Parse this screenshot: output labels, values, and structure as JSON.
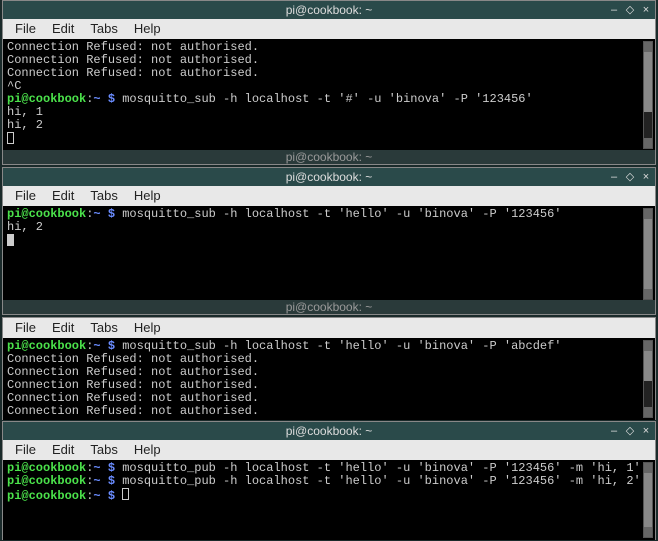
{
  "windows": [
    {
      "title": "pi@cookbook: ~",
      "menu": [
        "File",
        "Edit",
        "Tabs",
        "Help"
      ],
      "lines": [
        {
          "segs": [
            {
              "cls": "white",
              "t": "Connection Refused: not authorised."
            }
          ]
        },
        {
          "segs": [
            {
              "cls": "white",
              "t": "Connection Refused: not authorised."
            }
          ]
        },
        {
          "segs": [
            {
              "cls": "white",
              "t": "Connection Refused: not authorised."
            }
          ]
        },
        {
          "segs": [
            {
              "cls": "white",
              "t": "^C"
            }
          ]
        },
        {
          "segs": [
            {
              "cls": "green",
              "t": "pi@cookbook"
            },
            {
              "cls": "white",
              "t": ":"
            },
            {
              "cls": "blue",
              "t": "~ $ "
            },
            {
              "cls": "cmd",
              "t": "mosquitto_sub -h localhost -t '#' -u 'binova' -P '123456'"
            }
          ]
        },
        {
          "segs": [
            {
              "cls": "white",
              "t": "hi, 1"
            }
          ]
        },
        {
          "segs": [
            {
              "cls": "white",
              "t": "hi, 2"
            }
          ]
        }
      ],
      "cursor": "box",
      "partial_below": "pi@cookbook: ~"
    },
    {
      "title": "pi@cookbook: ~",
      "menu": [
        "File",
        "Edit",
        "Tabs",
        "Help"
      ],
      "lines": [
        {
          "segs": [
            {
              "cls": "green",
              "t": "pi@cookbook"
            },
            {
              "cls": "white",
              "t": ":"
            },
            {
              "cls": "blue",
              "t": "~ $ "
            },
            {
              "cls": "cmd",
              "t": "mosquitto_sub -h localhost -t 'hello' -u 'binova' -P '123456'"
            }
          ]
        },
        {
          "segs": [
            {
              "cls": "white",
              "t": "hi, 2"
            }
          ]
        }
      ],
      "cursor": "fill",
      "partial_below": "pi@cookbook: ~"
    },
    {
      "title": "",
      "menu": [
        "File",
        "Edit",
        "Tabs",
        "Help"
      ],
      "lines": [
        {
          "segs": [
            {
              "cls": "green",
              "t": "pi@cookbook"
            },
            {
              "cls": "white",
              "t": ":"
            },
            {
              "cls": "blue",
              "t": "~ $ "
            },
            {
              "cls": "cmd",
              "t": "mosquitto_sub -h localhost -t 'hello' -u 'binova' -P 'abcdef'"
            }
          ]
        },
        {
          "segs": [
            {
              "cls": "white",
              "t": "Connection Refused: not authorised."
            }
          ]
        },
        {
          "segs": [
            {
              "cls": "white",
              "t": "Connection Refused: not authorised."
            }
          ]
        },
        {
          "segs": [
            {
              "cls": "white",
              "t": "Connection Refused: not authorised."
            }
          ]
        },
        {
          "segs": [
            {
              "cls": "white",
              "t": "Connection Refused: not authorised."
            }
          ]
        },
        {
          "segs": [
            {
              "cls": "white",
              "t": "Connection Refused: not authorised."
            }
          ]
        }
      ],
      "cursor": "none"
    },
    {
      "title": "pi@cookbook: ~",
      "menu": [
        "File",
        "Edit",
        "Tabs",
        "Help"
      ],
      "lines": [
        {
          "segs": [
            {
              "cls": "green",
              "t": "pi@cookbook"
            },
            {
              "cls": "white",
              "t": ":"
            },
            {
              "cls": "blue",
              "t": "~ $ "
            },
            {
              "cls": "cmd",
              "t": "mosquitto_pub -h localhost -t 'hello' -u 'binova' -P '123456' -m 'hi, 1'"
            }
          ]
        },
        {
          "segs": [
            {
              "cls": "green",
              "t": "pi@cookbook"
            },
            {
              "cls": "white",
              "t": ":"
            },
            {
              "cls": "blue",
              "t": "~ $ "
            },
            {
              "cls": "cmd",
              "t": "mosquitto_pub -h localhost -t 'hello' -u 'binova' -P '123456' -m 'hi, 2'"
            }
          ]
        },
        {
          "segs": [
            {
              "cls": "green",
              "t": "pi@cookbook"
            },
            {
              "cls": "white",
              "t": ":"
            },
            {
              "cls": "blue",
              "t": "~ $ "
            }
          ]
        }
      ],
      "cursor": "box-inline"
    }
  ],
  "win_controls": {
    "min": "–",
    "max": "◇",
    "close": "×"
  }
}
